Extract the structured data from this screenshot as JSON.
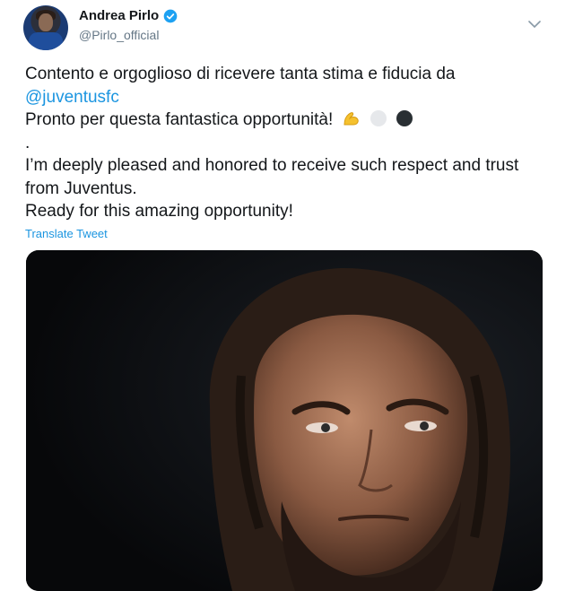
{
  "tweet": {
    "author_name": "Andrea Pirlo",
    "author_handle": "@Pirlo_official",
    "lines": [
      "Contento e orgoglioso di ricevere tanta stima e fiducia da",
      "Pronto per questa fantastica opportunità!",
      ".",
      "I’m deeply pleased and honored to receive such respect and trust",
      "from Juventus.",
      "Ready for this amazing opportunity!"
    ],
    "mention": "@juventusfc",
    "emojis": [
      "flexed-biceps",
      "white-circle",
      "black-circle"
    ],
    "translate_label": "Translate Tweet"
  },
  "icons": {
    "verified": "verified-badge-icon",
    "menu": "chevron-down-icon"
  },
  "colors": {
    "link": "#1b95e0",
    "secondary_text": "#657786",
    "primary_text": "#14171a"
  }
}
